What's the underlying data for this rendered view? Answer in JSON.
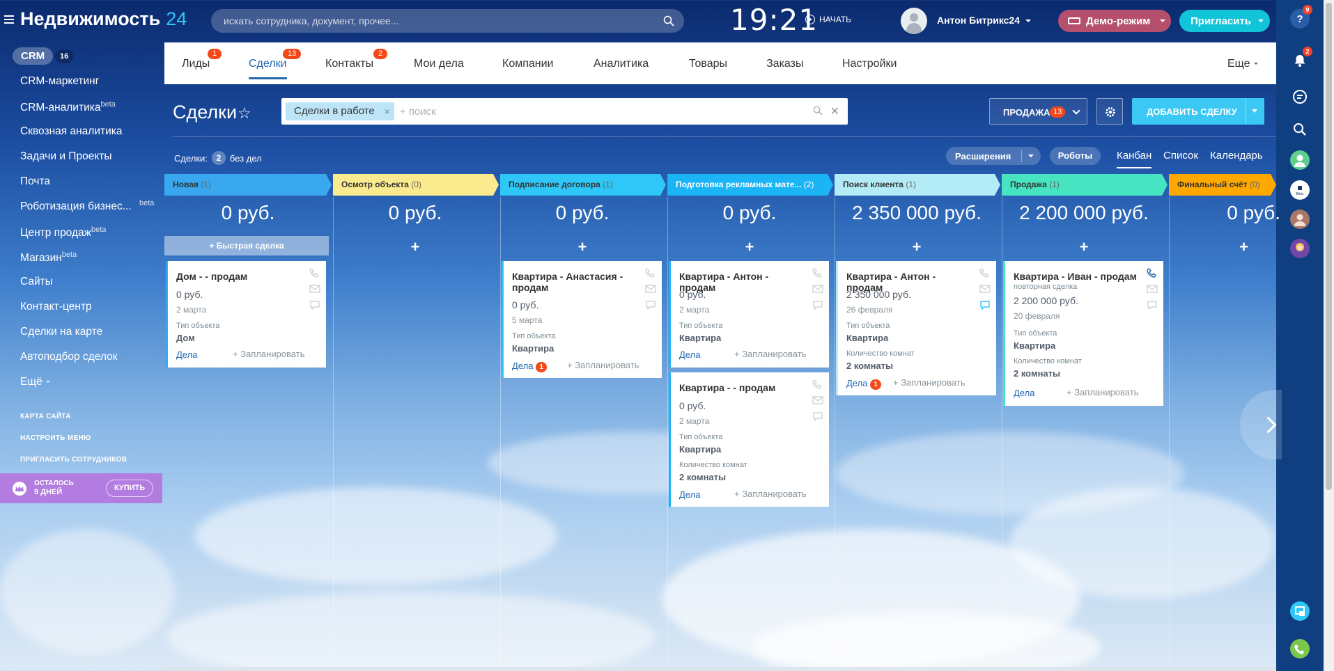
{
  "app": {
    "title": "Недвижимость",
    "title_num": "24"
  },
  "header": {
    "search_placeholder": "искать сотрудника, документ, прочее...",
    "clock": "19:21",
    "start_label": "НАЧАТЬ",
    "user_name": "Антон Битрикс24",
    "demo_label": "Демо-режим",
    "invite_label": "Пригласить"
  },
  "right_rail": {
    "help_badge": "9",
    "notif_badge": "2",
    "bitrix_label": "Bitrix"
  },
  "sidebar": {
    "crm_label": "CRM",
    "crm_count": "16",
    "items": [
      {
        "label": "CRM-маркетинг"
      },
      {
        "label": "CRM-аналитика",
        "sup": "beta"
      },
      {
        "label": "Сквозная аналитика"
      },
      {
        "label": "Задачи и Проекты"
      },
      {
        "label": "Почта"
      },
      {
        "label": "Роботизация бизнес...",
        "beta": "beta"
      },
      {
        "label": "Центр продаж",
        "sup": "beta"
      },
      {
        "label": "Магазин",
        "sup": "beta"
      },
      {
        "label": "Сайты"
      },
      {
        "label": "Контакт-центр"
      },
      {
        "label": "Сделки на карте"
      },
      {
        "label": "Автоподбор сделок"
      },
      {
        "label": "Ещё"
      }
    ],
    "links": [
      "КАРТА САЙТА",
      "НАСТРОИТЬ МЕНЮ",
      "ПРИГЛАСИТЬ СОТРУДНИКОВ"
    ],
    "trial_line1": "ОСТАЛОСЬ",
    "trial_line2": "9 ДНЕЙ",
    "buy_label": "КУПИТЬ"
  },
  "tabs": [
    {
      "label": "Лиды",
      "badge": "1"
    },
    {
      "label": "Сделки",
      "badge": "13"
    },
    {
      "label": "Контакты",
      "badge": "2"
    },
    {
      "label": "Мои дела"
    },
    {
      "label": "Компании"
    },
    {
      "label": "Аналитика"
    },
    {
      "label": "Товары"
    },
    {
      "label": "Заказы"
    },
    {
      "label": "Настройки"
    },
    {
      "label": "Еще"
    }
  ],
  "toolbar": {
    "page_title": "Сделки",
    "filter_chip": "Сделки в работе",
    "filter_placeholder": "+ поиск",
    "sale_label": "ПРОДАЖА",
    "sale_badge": "13",
    "add_label": "ДОБАВИТЬ СДЕЛКУ",
    "deals_label": "Сделки:",
    "deals_count": "2",
    "deals_suffix": "без дел",
    "extensions_label": "Расширения",
    "robots_label": "Роботы",
    "views": [
      "Канбан",
      "Список",
      "Календарь"
    ]
  },
  "kanban": {
    "quick_deal": "+ Быстрая сделка",
    "columns": [
      {
        "name": "Новая",
        "count": "(1)",
        "sum": "0 руб.",
        "color": "#39a8ef"
      },
      {
        "name": "Осмотр объекта",
        "count": "(0)",
        "sum": "0 руб.",
        "color": "#fbeb8e"
      },
      {
        "name": "Подписание договора",
        "count": "(1)",
        "sum": "0 руб.",
        "color": "#2fc7f7"
      },
      {
        "name": "Подготовка рекламных мате...",
        "count": "(2)",
        "sum": "0 руб.",
        "color": "#1bb5f5"
      },
      {
        "name": "Поиск клиента",
        "count": "(1)",
        "sum": "2 350 000 руб.",
        "color": "#b3ecf7"
      },
      {
        "name": "Продажа",
        "count": "(1)",
        "sum": "2 200 000 руб.",
        "color": "#47e4c2"
      },
      {
        "name": "Финальный счёт",
        "count": "(0)",
        "sum": "0 руб.",
        "color": "#ffa900"
      }
    ],
    "cards": [
      {
        "title": "Дом - - продам",
        "price": "0 руб.",
        "date": "2 марта",
        "f1_label": "Тип объекта",
        "f1_value": "Дом",
        "acts": "Дела",
        "plan": "+ Запланировать"
      },
      {
        "title": "Квартира - Анастасия - продам",
        "price": "0 руб.",
        "date": "5 марта",
        "f1_label": "Тип объекта",
        "f1_value": "Квартира",
        "acts": "Дела",
        "acts_badge": "1",
        "plan": "+ Запланировать"
      },
      {
        "title": "Квартира - Антон - продам",
        "price": "0 руб.",
        "date": "2 марта",
        "f1_label": "Тип объекта",
        "f1_value": "Квартира",
        "acts": "Дела",
        "plan": "+ Запланировать"
      },
      {
        "title": "Квартира - - продам",
        "price": "0 руб.",
        "date": "2 марта",
        "f1_label": "Тип объекта",
        "f1_value": "Квартира",
        "f2_label": "Количество комнат",
        "f2_value": "2 комнаты",
        "acts": "Дела",
        "plan": "+ Запланировать"
      },
      {
        "title": "Квартира - Антон - продам",
        "price": "2 350 000 руб.",
        "date": "26 февраля",
        "f1_label": "Тип объекта",
        "f1_value": "Квартира",
        "f2_label": "Количество комнат",
        "f2_value": "2 комнаты",
        "acts": "Дела",
        "acts_badge": "1",
        "plan": "+ Запланировать"
      },
      {
        "title": "Квартира - Иван - продам",
        "subtitle": "повторная сделка",
        "price": "2 200 000 руб.",
        "date": "20 февраля",
        "f1_label": "Тип объекта",
        "f1_value": "Квартира",
        "f2_label": "Количество комнат",
        "f2_value": "2 комнаты",
        "acts": "Дела",
        "plan": "+ Запланировать"
      }
    ]
  }
}
